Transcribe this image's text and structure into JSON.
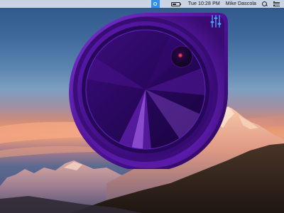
{
  "menubar": {
    "status_icon": "app-dial-status-icon",
    "battery_icon": "battery-icon",
    "clock": "Tue 10:28 PM",
    "user_name": "Mike Dascola",
    "search_icon": "search-icon",
    "notification_icon": "notification-list-icon"
  },
  "widget": {
    "settings_icon": "sliders-icon",
    "accent_color": "#7b2bd6",
    "knob_indicator_color": "#ff3a6a"
  },
  "colors": {
    "menubar_bg": "#ebf0f6",
    "panel_purple": "#5a1aa8",
    "status_blue": "#2f8ff5",
    "sliders_icon": "#4aa3ff"
  }
}
